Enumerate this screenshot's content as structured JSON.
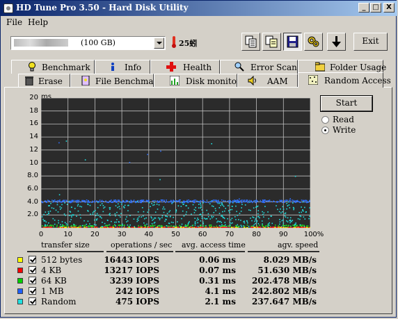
{
  "window": {
    "title": "HD Tune Pro 3.50 - Hard Disk Utility",
    "min_label": "_",
    "max_label": "□",
    "close_label": "X"
  },
  "menu": {
    "file": "File",
    "help": "Help"
  },
  "toolbar": {
    "drive_size": "(100 GB)",
    "temperature": "25蚓",
    "exit_label": "Exit",
    "icons": [
      "copy-info-icon",
      "copy-text-icon",
      "save-icon",
      "settings-icon",
      "download-icon"
    ]
  },
  "tabs_top": [
    {
      "label": "Benchmark",
      "icon": "lightbulb-icon"
    },
    {
      "label": "Info",
      "icon": "info-icon"
    },
    {
      "label": "Health",
      "icon": "health-cross-icon"
    },
    {
      "label": "Error Scan",
      "icon": "magnifier-icon"
    },
    {
      "label": "Folder Usage",
      "icon": "folder-icon"
    }
  ],
  "tabs_bottom": [
    {
      "label": "Erase",
      "icon": "trash-icon"
    },
    {
      "label": "File Benchmark",
      "icon": "file-benchmark-icon"
    },
    {
      "label": "Disk monitor",
      "icon": "disk-monitor-icon"
    },
    {
      "label": "AAM",
      "icon": "speaker-icon"
    },
    {
      "label": "Random Access",
      "icon": "random-access-icon",
      "active": true
    }
  ],
  "chart": {
    "y_unit": "ms",
    "y_ticks": [
      "20",
      "18",
      "16",
      "14",
      "12",
      "10",
      "8.0",
      "6.0",
      "4.0",
      "2.0"
    ],
    "x_ticks": [
      "0",
      "10",
      "20",
      "30",
      "40",
      "50",
      "60",
      "70",
      "80",
      "90",
      "100%"
    ],
    "background": "#2b2b2b",
    "grid_color": "#c0c0c0"
  },
  "chart_data": {
    "type": "scatter",
    "ylabel": "ms",
    "xlim": [
      0,
      100
    ],
    "ylim": [
      0,
      20
    ],
    "x_unit": "%",
    "grid": true,
    "series": [
      {
        "name": "512 bytes",
        "color": "#ffff00",
        "y_range": [
          0.02,
          0.12
        ]
      },
      {
        "name": "4 KB",
        "color": "#ff2020",
        "y_range": [
          0.03,
          0.14
        ]
      },
      {
        "name": "64 KB",
        "color": "#20e020",
        "y_range": [
          0.2,
          0.45
        ]
      },
      {
        "name": "1 MB",
        "color": "#3070ff",
        "y_range": [
          3.9,
          4.3
        ]
      },
      {
        "name": "Random",
        "color": "#20e0e0",
        "y_range": [
          0.2,
          4.2
        ]
      }
    ]
  },
  "controls": {
    "start_label": "Start",
    "read_label": "Read",
    "write_label": "Write",
    "selected": "Write"
  },
  "results": {
    "headers": [
      "transfer size",
      "operations / sec",
      "avg. access time",
      "agv. speed"
    ],
    "rows": [
      {
        "size": "512 bytes",
        "color": "#ffff00",
        "ops": "16443 IOPS",
        "access": "0.06 ms",
        "speed": "8.029 MB/s"
      },
      {
        "size": "4 KB",
        "color": "#ff0000",
        "ops": "13217 IOPS",
        "access": "0.07 ms",
        "speed": "51.630 MB/s"
      },
      {
        "size": "64 KB",
        "color": "#00d000",
        "ops": "3239 IOPS",
        "access": "0.31 ms",
        "speed": "202.478 MB/s"
      },
      {
        "size": "1 MB",
        "color": "#2060ff",
        "ops": "242 IOPS",
        "access": "4.1 ms",
        "speed": "242.802 MB/s"
      },
      {
        "size": "Random",
        "color": "#20e0e0",
        "ops": "475 IOPS",
        "access": "2.1 ms",
        "speed": "237.647 MB/s"
      }
    ]
  }
}
